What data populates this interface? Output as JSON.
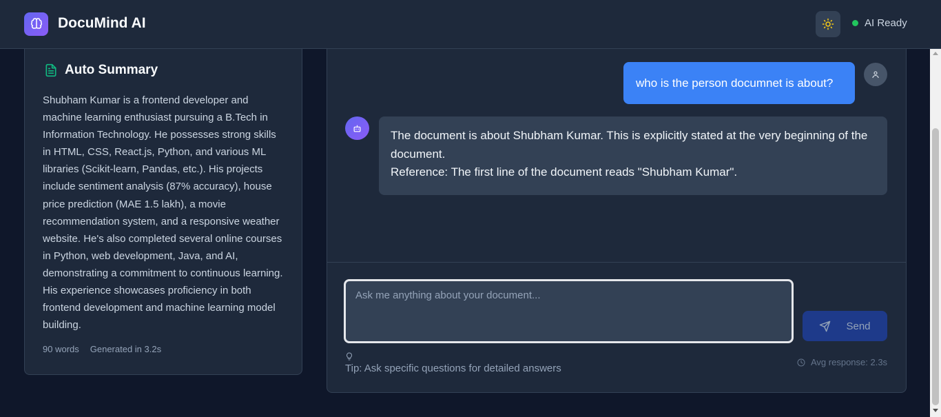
{
  "header": {
    "app_title": "DocuMind AI",
    "status_text": "AI Ready",
    "status_color": "#22c55e",
    "logo_icon": "brain-icon",
    "theme_icon": "sun-icon"
  },
  "summary": {
    "title": "Auto Summary",
    "icon": "document-icon",
    "text": "Shubham Kumar is a frontend developer and machine learning enthusiast pursuing a B.Tech in Information Technology. He possesses strong skills in HTML, CSS, React.js, Python, and various ML libraries (Scikit-learn, Pandas, etc.). His projects include sentiment analysis (87% accuracy), house price prediction (MAE 1.5 lakh), a movie recommendation system, and a responsive weather website. He's also completed several online courses in Python, web development, Java, and AI, demonstrating a commitment to continuous learning. His experience showcases proficiency in both frontend development and machine learning model building.",
    "word_count": "90 words",
    "generated": "Generated in 3.2s"
  },
  "chat": {
    "user_message": "who is the person documnet is about?",
    "bot_line1": "The document is about Shubham Kumar.  This is explicitly stated at the very beginning of the document.",
    "bot_line2": "Reference: The first line of the document reads \"Shubham Kumar\".",
    "input_placeholder": "Ask me anything about your document...",
    "send_label": "Send",
    "tip": "Tip: Ask specific questions for detailed answers",
    "avg_response": "Avg response: 2.3s"
  },
  "colors": {
    "accent": "#3b82f6",
    "background": "#0f172a",
    "panel": "#1e293b"
  }
}
